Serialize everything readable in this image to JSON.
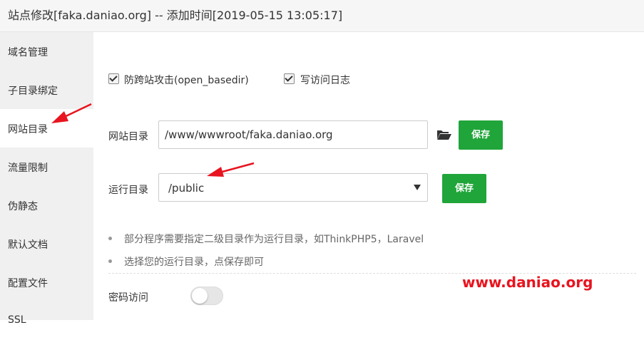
{
  "title": "站点修改[faka.daniao.org] -- 添加时间[2019-05-15 13:05:17]",
  "sidebar": {
    "items": [
      {
        "label": "域名管理"
      },
      {
        "label": "子目录绑定"
      },
      {
        "label": "网站目录"
      },
      {
        "label": "流量限制"
      },
      {
        "label": "伪静态"
      },
      {
        "label": "默认文档"
      },
      {
        "label": "配置文件"
      },
      {
        "label": "SSL"
      }
    ],
    "active": "网站目录"
  },
  "options": {
    "open_basedir_label": "防跨站攻击(open_basedir)",
    "open_basedir_checked": true,
    "access_log_label": "写访问日志",
    "access_log_checked": true
  },
  "site_dir": {
    "label": "网站目录",
    "value": "/www/wwwroot/faka.daniao.org",
    "folder_icon": "folder-open-icon",
    "save_label": "保存"
  },
  "run_dir": {
    "label": "运行目录",
    "value": "/public",
    "save_label": "保存"
  },
  "hints": [
    "部分程序需要指定二级目录作为运行目录，如ThinkPHP5，Laravel",
    "选择您的运行目录，点保存即可"
  ],
  "password_access": {
    "label": "密码访问",
    "enabled": false
  },
  "watermark": "www.daniao.org",
  "colors": {
    "accent": "#20a53a",
    "annotation": "#e8141f"
  }
}
